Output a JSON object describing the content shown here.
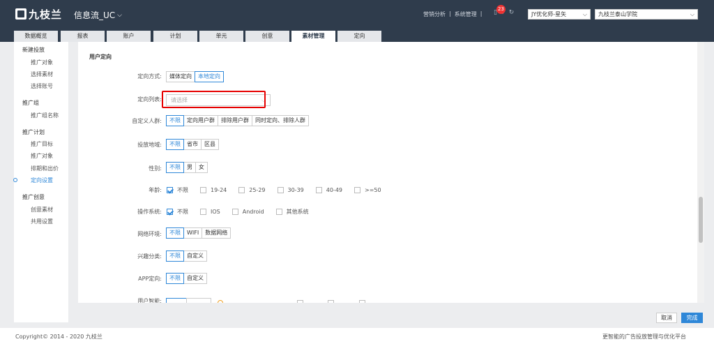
{
  "header": {
    "logo_text": "九枝兰",
    "app_title": "信息流_UC",
    "links": [
      "营销分析",
      "|",
      "系统管理",
      "|"
    ],
    "notification_count": "23",
    "account_select": "JY优化师-星矢",
    "org_select": "九枝兰泰山学院"
  },
  "tabs": [
    {
      "label": "数据概览"
    },
    {
      "label": "报表"
    },
    {
      "label": "账户"
    },
    {
      "label": "计划"
    },
    {
      "label": "单元"
    },
    {
      "label": "创意"
    },
    {
      "label": "素材管理"
    },
    {
      "label": "定向"
    }
  ],
  "sidebar": {
    "groups": [
      {
        "title": "新建投放",
        "items": [
          "推广对象",
          "选择素材",
          "选择账号"
        ]
      },
      {
        "title": "推广组",
        "items": [
          "推广组名称"
        ]
      },
      {
        "title": "推广计划",
        "items": [
          "推广目标",
          "推广对象",
          "排期和出价",
          "定向设置"
        ]
      },
      {
        "title": "推广创意",
        "items": [
          "创意素材",
          "共用设置"
        ]
      }
    ]
  },
  "form": {
    "section_title": "用户定向",
    "targeting_mode": {
      "label": "定向方式:",
      "options": [
        "媒体定向",
        "本地定向"
      ]
    },
    "targeting_list": {
      "label": "定向列表:",
      "placeholder": "请选择"
    },
    "custom_audience": {
      "label": "自定义人群:",
      "options": [
        "不限",
        "定向用户群",
        "排除用户群",
        "同时定向、排除人群"
      ]
    },
    "region": {
      "label": "投放地域:",
      "options": [
        "不限",
        "省市",
        "区县"
      ]
    },
    "gender": {
      "label": "性别:",
      "options": [
        "不限",
        "男",
        "女"
      ]
    },
    "age": {
      "label": "年龄:",
      "options": [
        "不限",
        "19-24",
        "25-29",
        "30-39",
        "40-49",
        ">=50"
      ]
    },
    "os": {
      "label": "操作系统:",
      "options": [
        "不限",
        "IOS",
        "Android",
        "其他系统"
      ]
    },
    "network": {
      "label": "网络环境:",
      "options": [
        "不限",
        "WIFI",
        "数据网络"
      ]
    },
    "interest": {
      "label": "兴趣分类:",
      "options": [
        "不限",
        "自定义"
      ]
    },
    "app": {
      "label": "APP定向:",
      "options": [
        "不限",
        "自定义"
      ]
    },
    "smart": {
      "label": "用户智能:"
    }
  },
  "actions": {
    "cancel": "取消",
    "done": "完成"
  },
  "footer": {
    "copyright": "Copyright© 2014 - 2020 九枝兰",
    "slogan": "更智能的广告投放管理与优化平台"
  },
  "colors": {
    "header": "#2f3c4c",
    "accent": "#2e87d8",
    "highlight_box": "#e60000"
  }
}
